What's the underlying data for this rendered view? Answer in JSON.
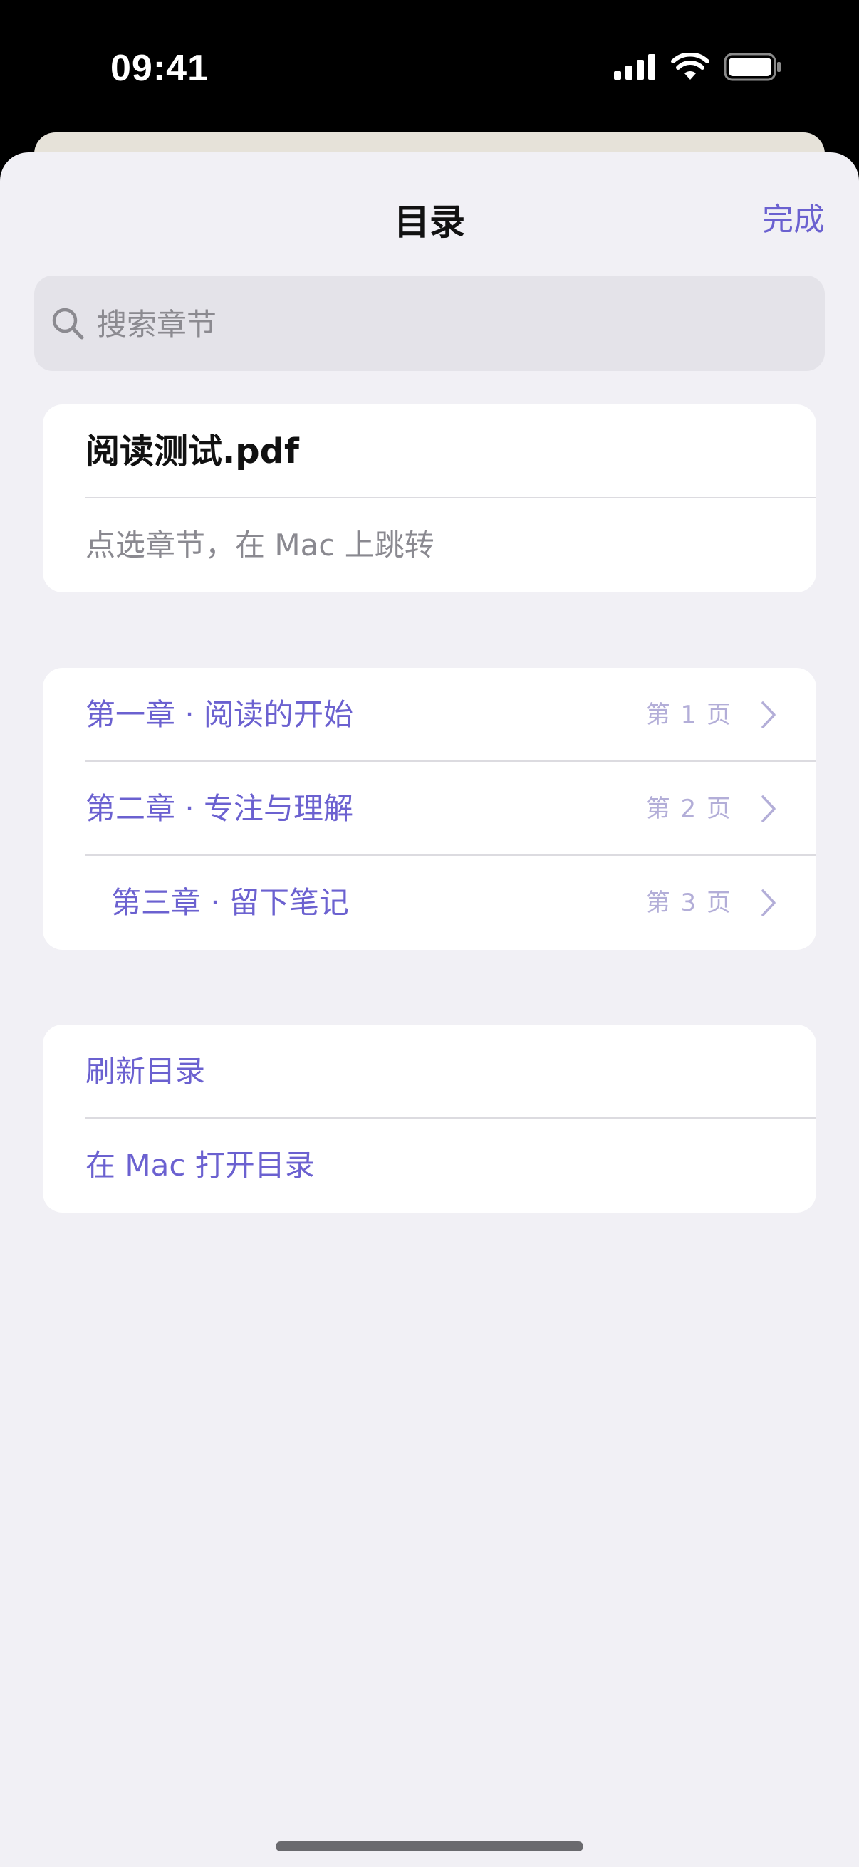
{
  "status_bar": {
    "time": "09:41"
  },
  "nav": {
    "title": "目录",
    "done_label": "完成"
  },
  "search": {
    "placeholder": "搜索章节",
    "value": ""
  },
  "document": {
    "title": "阅读测试.pdf",
    "hint": "点选章节，在 Mac 上跳转"
  },
  "chapters": [
    {
      "label": "第一章 · 阅读的开始",
      "page": "第 1 页",
      "indent": 0
    },
    {
      "label": "第二章 · 专注与理解",
      "page": "第 2 页",
      "indent": 0
    },
    {
      "label": "第三章 · 留下笔记",
      "page": "第 3 页",
      "indent": 1
    }
  ],
  "actions": {
    "refresh_label": "刷新目录",
    "open_on_mac_label": "在 Mac 打开目录"
  },
  "colors": {
    "accent": "#6b61d0",
    "page_label": "#b3aed8",
    "sheet_bg": "#f1f0f5"
  },
  "icons": [
    "signal-icon",
    "wifi-icon",
    "battery-icon",
    "search-icon",
    "chevron-right-icon"
  ]
}
